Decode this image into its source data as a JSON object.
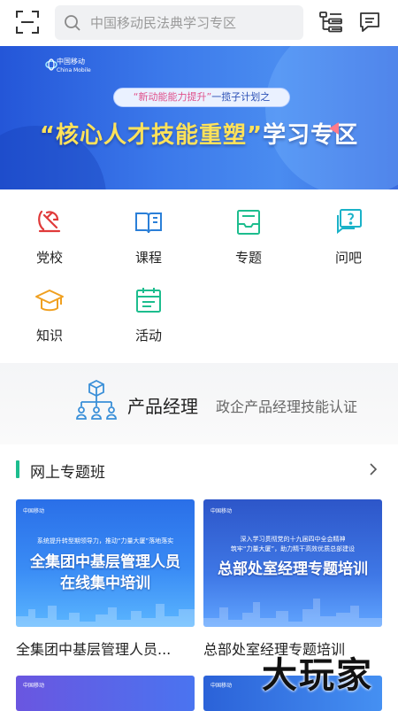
{
  "search": {
    "placeholder": "中国移动民法典学习专区"
  },
  "banner": {
    "logo_text": "中国移动",
    "logo_sub": "China Mobile",
    "subtitle_pink": "“新动能能力提升”",
    "subtitle_rest": "一揽子计划之",
    "title_yellow": "“核心人才技能重塑”",
    "title_white": "学习专区"
  },
  "grid": [
    {
      "label": "党校",
      "icon": "party-emblem-icon",
      "color": "#e03a3a"
    },
    {
      "label": "课程",
      "icon": "book-icon",
      "color": "#2a7fd8"
    },
    {
      "label": "专题",
      "icon": "inbox-icon",
      "color": "#1dbd8e"
    },
    {
      "label": "问吧",
      "icon": "question-chat-icon",
      "color": "#1ab2c8"
    },
    {
      "label": "知识",
      "icon": "graduation-cap-icon",
      "color": "#f0a020"
    },
    {
      "label": "活动",
      "icon": "calendar-icon",
      "color": "#1dbd8e"
    }
  ],
  "product": {
    "title": "产品经理",
    "desc": "政企产品经理技能认证"
  },
  "section": {
    "title": "网上专题班"
  },
  "courses": [
    {
      "logo": "中国移动",
      "banner_top": "系统提升转型期领导力，推动“力量大厦”落地落实",
      "banner_line1": "全集团中基层管理人员",
      "banner_line2": "在线集中培训",
      "caption": "全集团中基层管理人员..."
    },
    {
      "logo": "中国移动",
      "banner_top1": "深入学习贯彻党的十九届四中全会精神",
      "banner_top2": "筑牢“力量大厦”，助力精干高效优质总部建设",
      "banner_line1": "总部处室经理专题培训",
      "caption": "总部处室经理专题培训"
    }
  ],
  "more_courses": [
    {
      "logo": "中国移动"
    },
    {
      "logo": "中国移动"
    }
  ],
  "watermark": "大玩家"
}
